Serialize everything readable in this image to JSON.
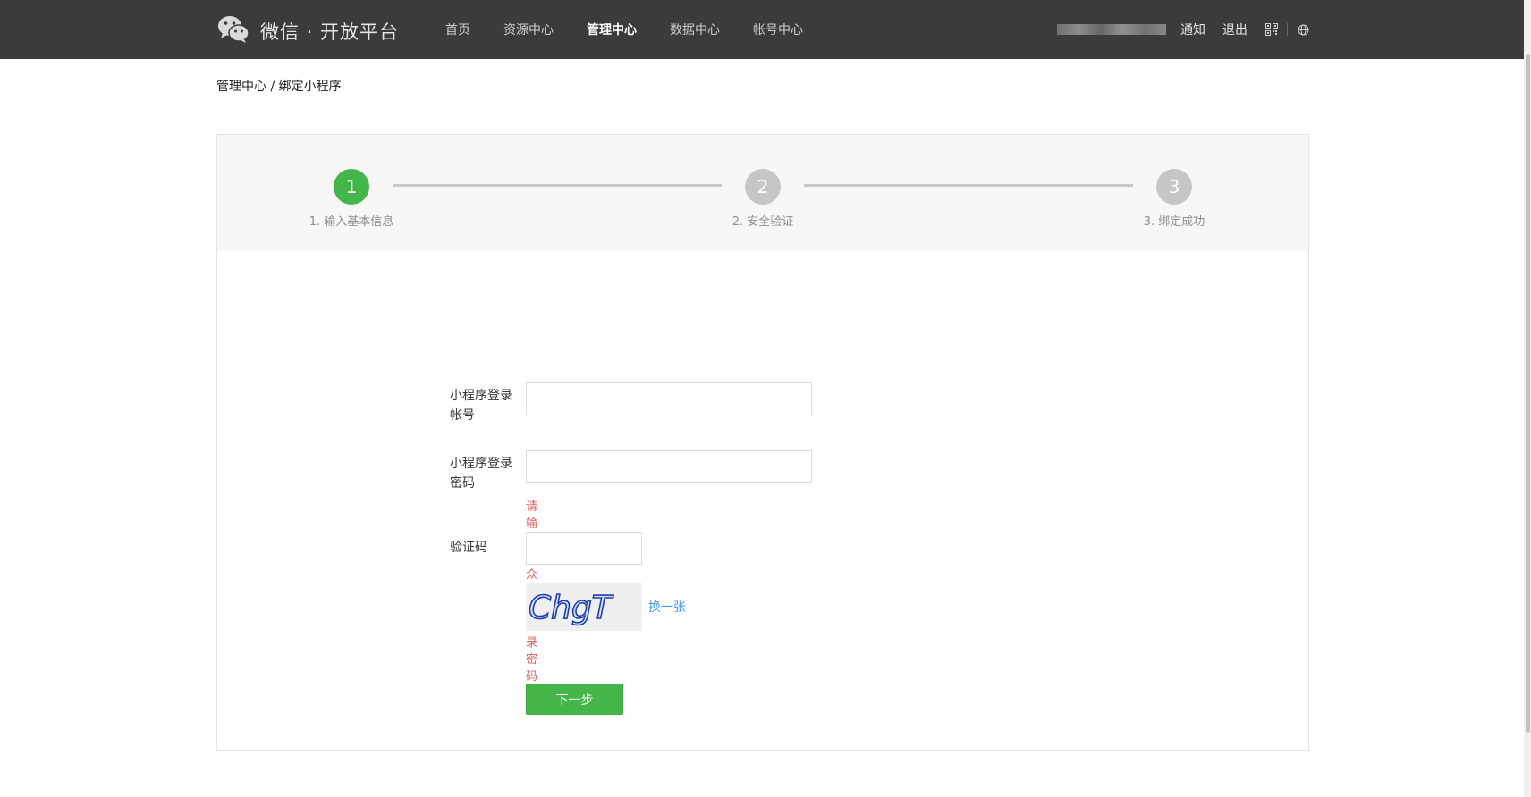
{
  "header": {
    "logo_text": "微信 · 开放平台",
    "nav": [
      {
        "label": "首页",
        "active": false
      },
      {
        "label": "资源中心",
        "active": false
      },
      {
        "label": "管理中心",
        "active": true
      },
      {
        "label": "数据中心",
        "active": false
      },
      {
        "label": "帐号中心",
        "active": false
      }
    ],
    "notify_label": "通知",
    "logout_label": "退出",
    "icons": [
      "qrcode-icon",
      "globe-icon"
    ]
  },
  "breadcrumb": "管理中心 / 绑定小程序",
  "steps": [
    {
      "number": "1",
      "label": "1. 输入基本信息",
      "state": "active"
    },
    {
      "number": "2",
      "label": "2. 安全验证",
      "state": "inactive"
    },
    {
      "number": "3",
      "label": "3. 绑定成功",
      "state": "inactive"
    }
  ],
  "form": {
    "account_label": "小程序登录帐号",
    "account_value": "",
    "password_label": "小程序登录密码",
    "password_value": "",
    "password_error": "请输入公众帐号登录密码",
    "captcha_label": "验证码",
    "captcha_value": "",
    "captcha_text": "ChgT",
    "change_captcha_label": "换一张",
    "next_button_label": "下一步"
  },
  "colors": {
    "topbar": "#3b3b3b",
    "accent_green": "#44b549",
    "error_red": "#e15f63",
    "link_blue": "#459ae9"
  }
}
